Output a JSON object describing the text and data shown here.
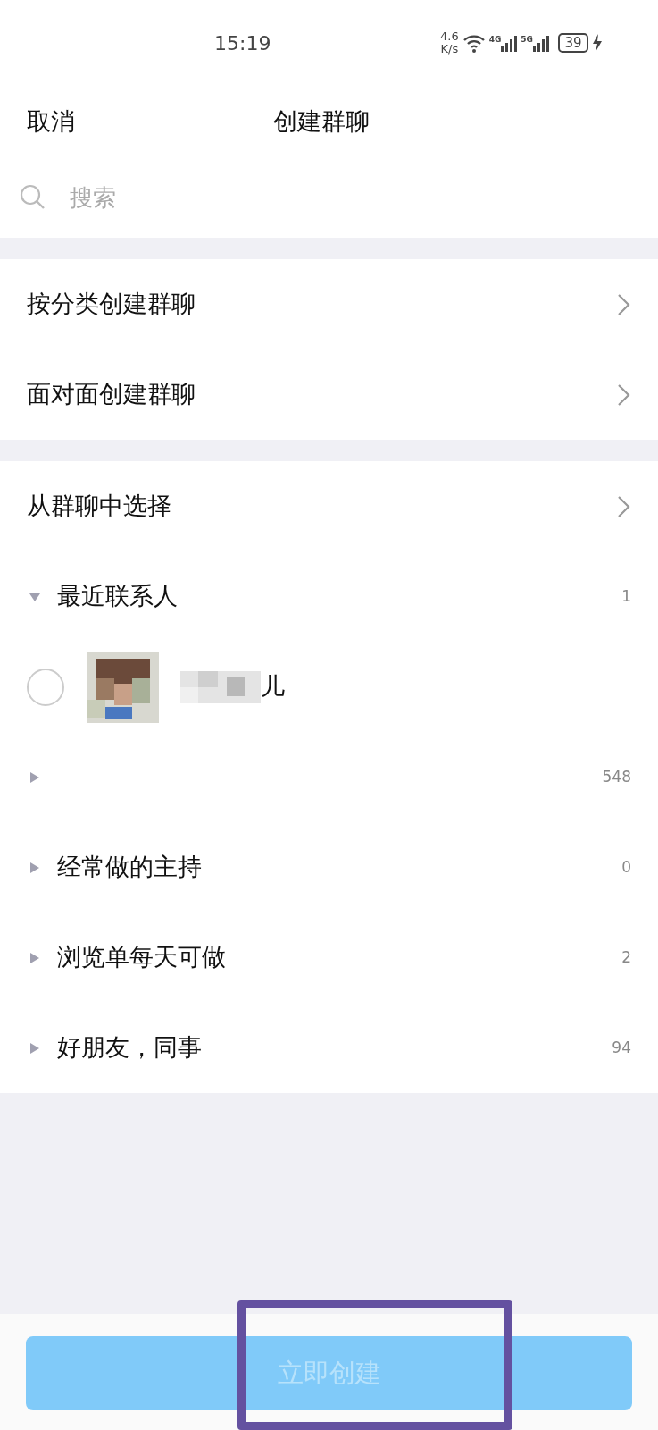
{
  "status_bar": {
    "time": "15:19",
    "speed_value": "4.6",
    "speed_unit": "K/s",
    "net_1": "4G",
    "net_2": "5G",
    "battery": "39"
  },
  "nav": {
    "cancel": "取消",
    "title": "创建群聊"
  },
  "search": {
    "placeholder": "搜索"
  },
  "entries": [
    {
      "label": "按分类创建群聊"
    },
    {
      "label": "面对面创建群聊"
    }
  ],
  "picker": {
    "label": "从群聊中选择"
  },
  "groups": [
    {
      "name": "最近联系人",
      "count": "1",
      "expanded": true,
      "contacts": [
        {
          "name": "儿",
          "selected": false
        }
      ]
    },
    {
      "count": "548",
      "expanded": false
    },
    {
      "name": "经常做的主持",
      "count": "0",
      "expanded": false
    },
    {
      "name": "浏览单每天可做",
      "count": "2",
      "expanded": false
    },
    {
      "name": "好朋友，同事",
      "count": "94",
      "expanded": false
    }
  ],
  "create_button": {
    "label": "立即创建",
    "disabled": true
  }
}
